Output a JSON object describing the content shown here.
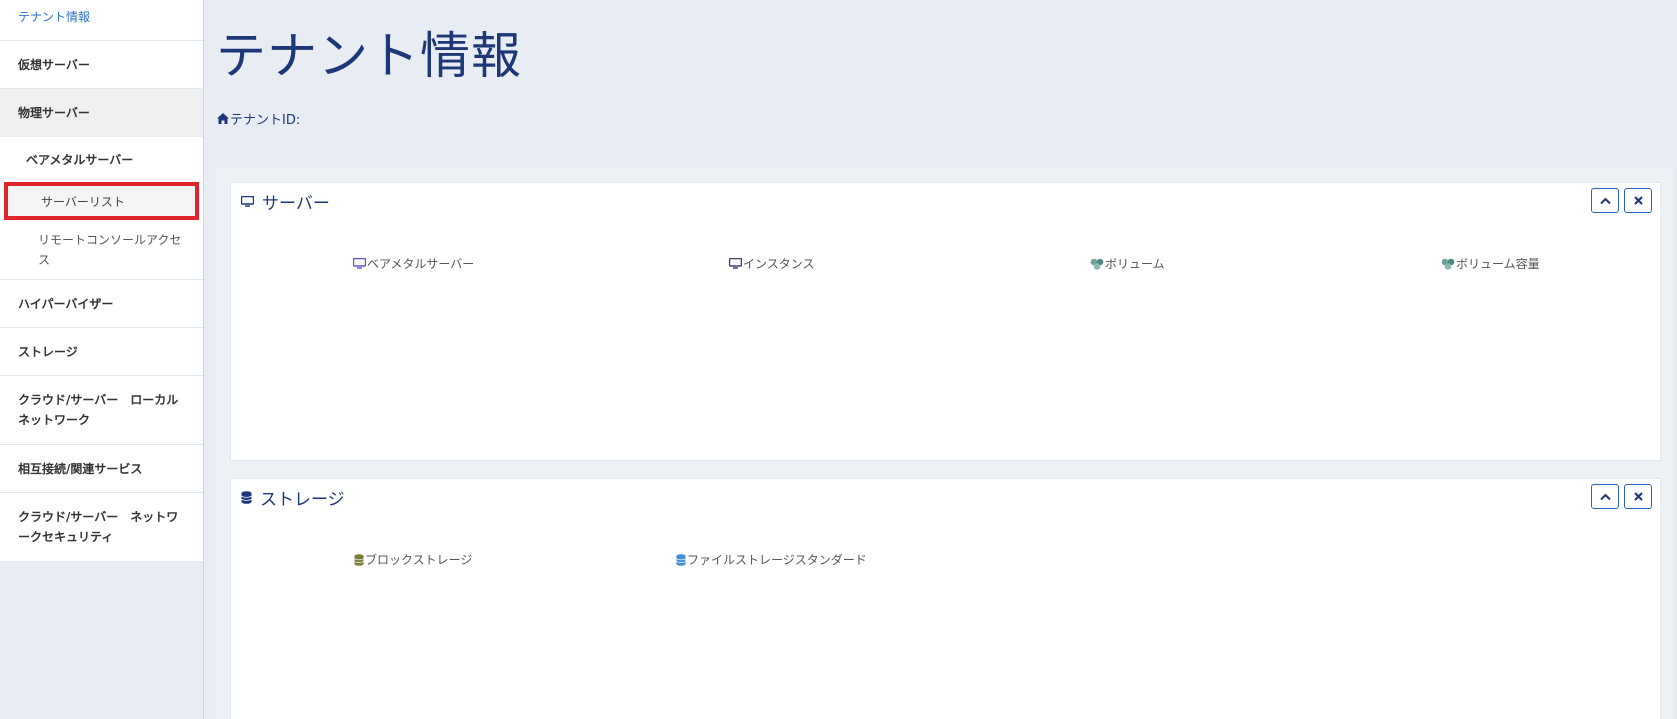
{
  "sidebar": {
    "items": [
      {
        "label": "テナント情報"
      },
      {
        "label": "仮想サーバー"
      },
      {
        "label": "物理サーバー"
      },
      {
        "label": "ベアメタルサーバー"
      },
      {
        "label": "サーバーリスト"
      },
      {
        "label": "リモートコンソールアクセス"
      },
      {
        "label": "ハイパーバイザー"
      },
      {
        "label": "ストレージ"
      },
      {
        "label": "クラウド/サーバー　ローカルネットワーク"
      },
      {
        "label": "相互接続/関連サービス"
      },
      {
        "label": "クラウド/サーバー　ネットワークセキュリティ"
      }
    ]
  },
  "main": {
    "title": "テナント情報",
    "tenant_id_label": "テナントID:",
    "server_panel": {
      "title": "サーバー",
      "stats": [
        "ベアメタルサーバー",
        "インスタンス",
        "ボリューム",
        "ボリューム容量"
      ]
    },
    "storage_panel": {
      "title": "ストレージ",
      "stats": [
        "ブロックストレージ",
        "ファイルストレージスタンダード"
      ]
    }
  },
  "icons": {
    "monitor": "monitor-icon",
    "database": "database-icon",
    "home": "home-icon",
    "chevron_up": "chevron-up-icon",
    "close": "close-icon",
    "volume": "volume-icon"
  },
  "colors": {
    "accent": "#1d3778",
    "link": "#2a73c9",
    "highlight_border": "#e0242b",
    "button_border": "#2a63b8"
  }
}
